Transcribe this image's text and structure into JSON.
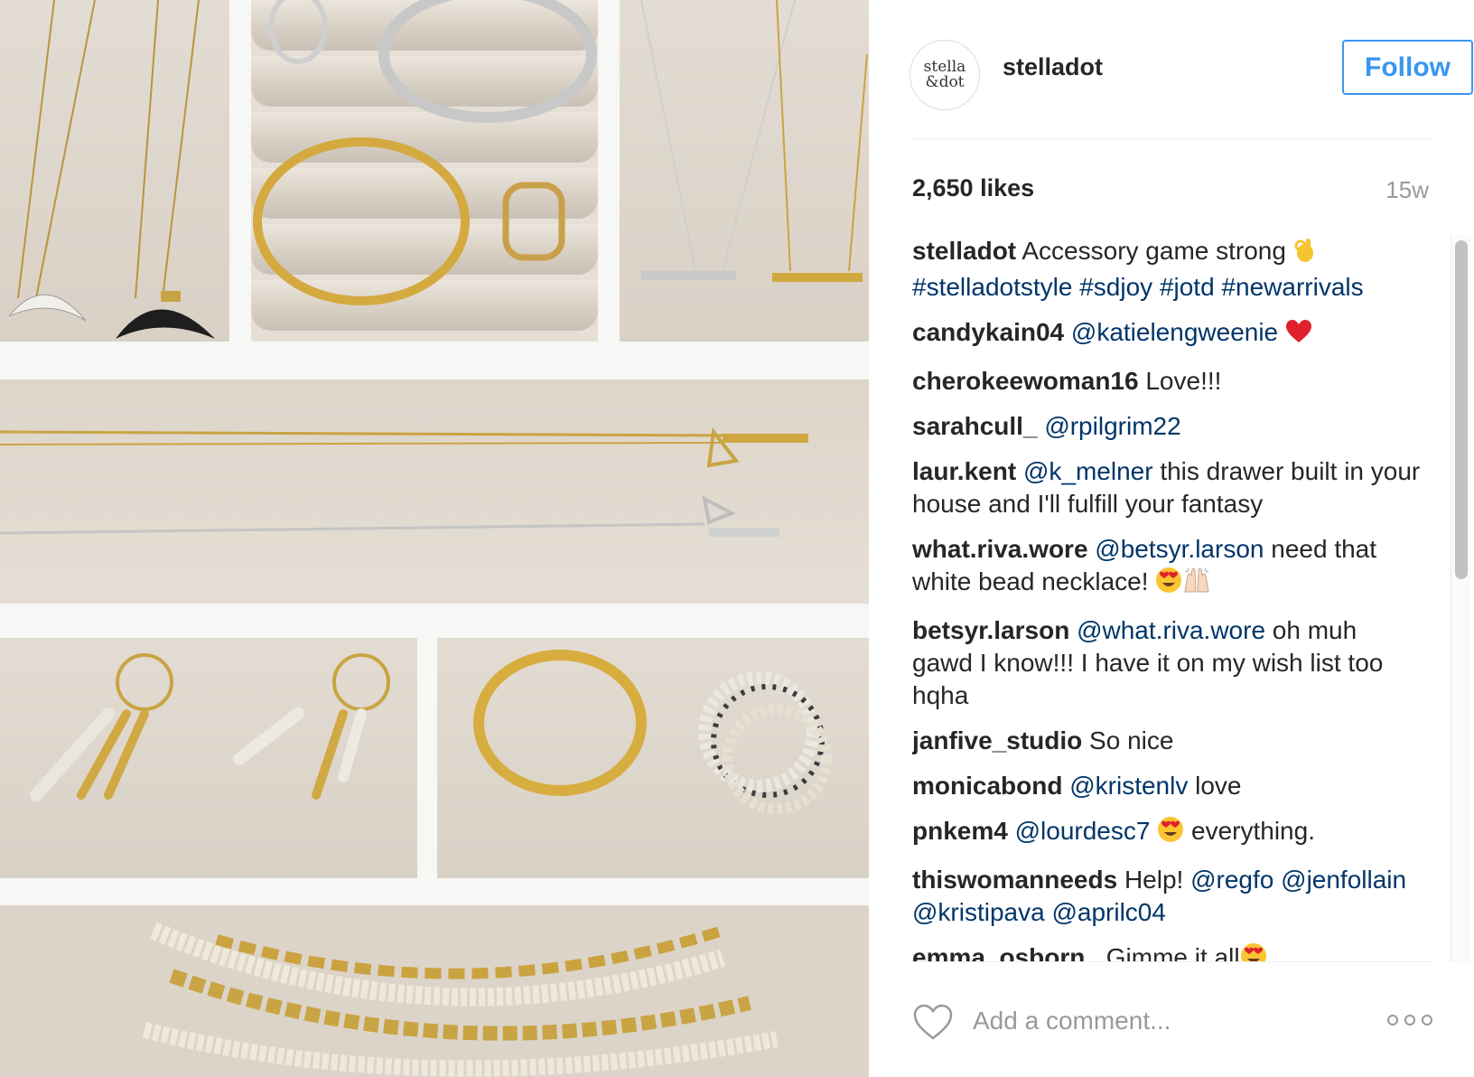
{
  "photo": {
    "alt_icon": "jewelry-tray-photo"
  },
  "header": {
    "avatar_line1": "stella",
    "avatar_line2": "&dot",
    "username": "stelladot",
    "follow_label": "Follow"
  },
  "stats": {
    "likes": "2,650 likes",
    "age": "15w"
  },
  "comments": [
    {
      "user": "stelladot",
      "parts": [
        {
          "t": "text",
          "v": "Accessory game strong "
        },
        {
          "t": "emoji",
          "v": "ok-hand-emoji"
        },
        {
          "t": "text",
          "v": " "
        },
        {
          "t": "tag",
          "v": "#stelladotstyle"
        },
        {
          "t": "text",
          "v": " "
        },
        {
          "t": "tag",
          "v": "#sdjoy"
        },
        {
          "t": "text",
          "v": " "
        },
        {
          "t": "tag",
          "v": "#jotd"
        },
        {
          "t": "text",
          "v": " "
        },
        {
          "t": "tag",
          "v": "#newarrivals"
        }
      ]
    },
    {
      "user": "candykain04",
      "parts": [
        {
          "t": "tag",
          "v": "@katielengweenie"
        },
        {
          "t": "text",
          "v": " "
        },
        {
          "t": "emoji",
          "v": "red-heart-emoji"
        }
      ]
    },
    {
      "user": "cherokeewoman16",
      "parts": [
        {
          "t": "text",
          "v": "Love!!!"
        }
      ]
    },
    {
      "user": "sarahcull_",
      "parts": [
        {
          "t": "tag",
          "v": "@rpilgrim22"
        }
      ]
    },
    {
      "user": "laur.kent",
      "parts": [
        {
          "t": "tag",
          "v": "@k_melner"
        },
        {
          "t": "text",
          "v": " this drawer built in your house and I'll fulfill your fantasy"
        }
      ]
    },
    {
      "user": "what.riva.wore",
      "parts": [
        {
          "t": "tag",
          "v": "@betsyr.larson"
        },
        {
          "t": "text",
          "v": " need that white bead necklace! "
        },
        {
          "t": "emoji",
          "v": "heart-eyes-emoji"
        },
        {
          "t": "emoji",
          "v": "raised-hands-emoji"
        }
      ]
    },
    {
      "user": "betsyr.larson",
      "parts": [
        {
          "t": "tag",
          "v": "@what.riva.wore"
        },
        {
          "t": "text",
          "v": " oh muh gawd I know!!! I have it on my wish list too hqha"
        }
      ]
    },
    {
      "user": "janfive_studio",
      "parts": [
        {
          "t": "text",
          "v": "So nice"
        }
      ]
    },
    {
      "user": "monicabond",
      "parts": [
        {
          "t": "tag",
          "v": "@kristenlv"
        },
        {
          "t": "text",
          "v": " love"
        }
      ]
    },
    {
      "user": "pnkem4",
      "parts": [
        {
          "t": "tag",
          "v": "@lourdesc7"
        },
        {
          "t": "text",
          "v": " "
        },
        {
          "t": "emoji",
          "v": "heart-eyes-emoji"
        },
        {
          "t": "text",
          "v": " everything."
        }
      ]
    },
    {
      "user": "thiswomanneeds",
      "parts": [
        {
          "t": "text",
          "v": "Help! "
        },
        {
          "t": "tag",
          "v": "@regfo"
        },
        {
          "t": "text",
          "v": " "
        },
        {
          "t": "tag",
          "v": "@jenfollain"
        },
        {
          "t": "text",
          "v": " "
        },
        {
          "t": "tag",
          "v": "@kristipava"
        },
        {
          "t": "text",
          "v": " "
        },
        {
          "t": "tag",
          "v": "@aprilc04"
        }
      ]
    },
    {
      "user": "emma_osborn_",
      "parts": [
        {
          "t": "text",
          "v": "Gimme it all"
        },
        {
          "t": "emoji",
          "v": "heart-eyes-emoji"
        }
      ]
    }
  ],
  "footer": {
    "comment_placeholder": "Add a comment...",
    "like_icon": "heart-outline-icon",
    "more_icon": "more-options-icon"
  },
  "colors": {
    "accent": "#3897f0",
    "tag": "#003569",
    "muted": "#999999",
    "text": "#262626"
  }
}
